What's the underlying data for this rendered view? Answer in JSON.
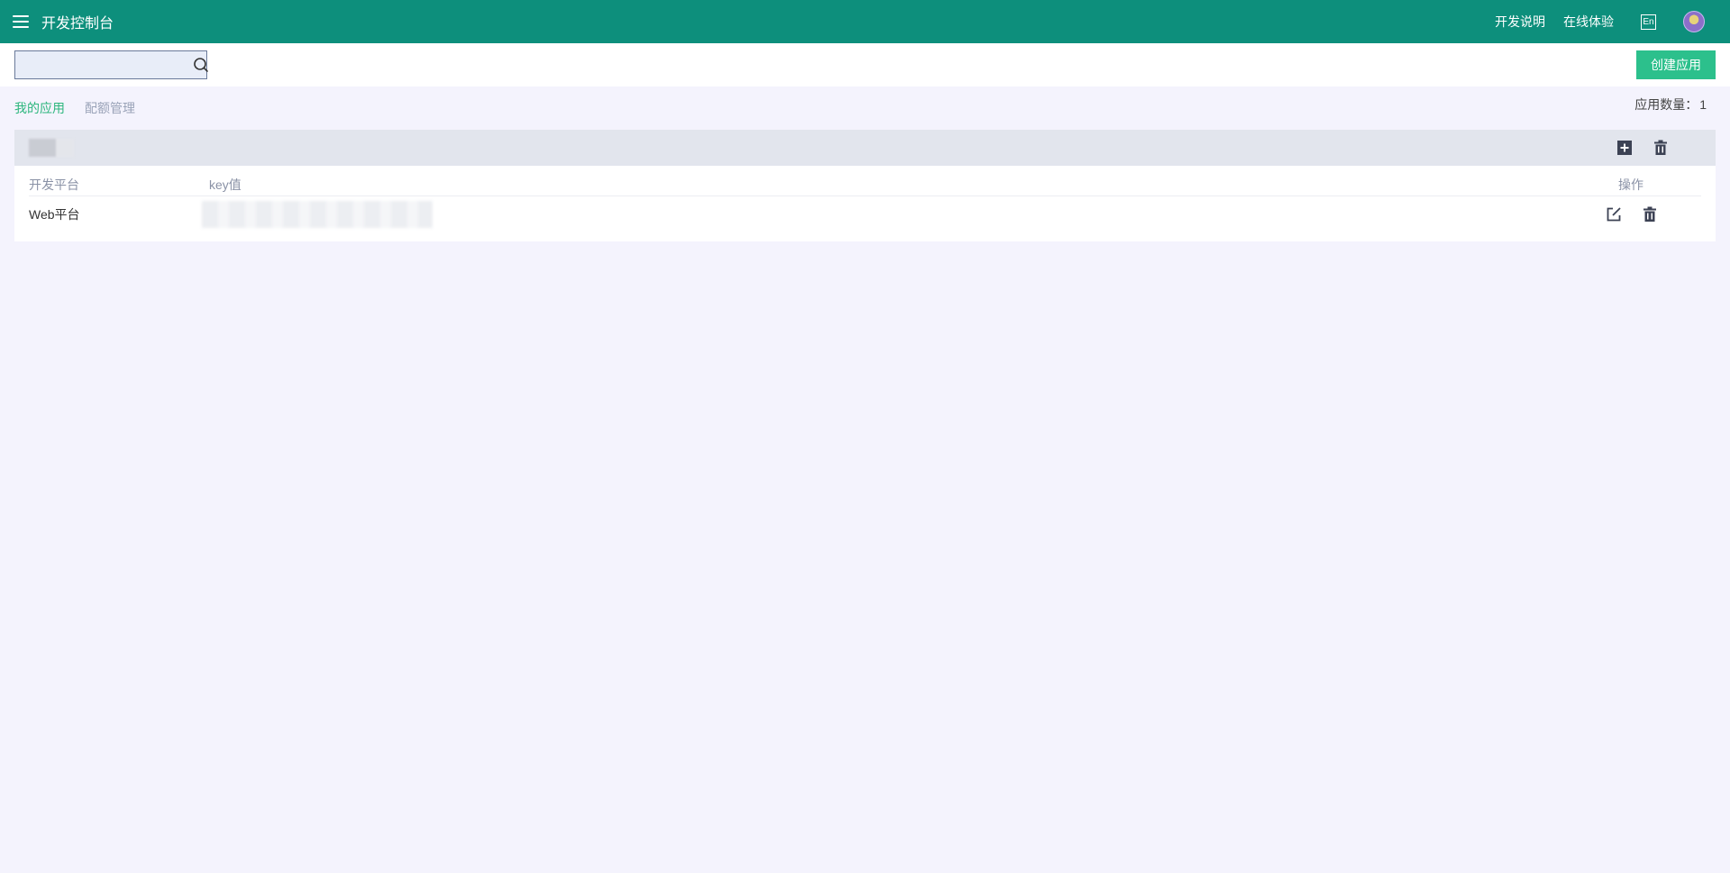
{
  "header": {
    "title": "开发控制台",
    "links": [
      "开发说明",
      "在线体验"
    ],
    "lang_label": "En"
  },
  "toolbar": {
    "search_value": "",
    "create_label": "创建应用"
  },
  "tabs": [
    {
      "label": "我的应用",
      "active": true
    },
    {
      "label": "配额管理",
      "active": false
    }
  ],
  "app_count": {
    "label": "应用数量：",
    "value": "1"
  },
  "table": {
    "columns": [
      "开发平台",
      "key值",
      "操作"
    ],
    "rows": [
      {
        "platform": "Web平台"
      }
    ]
  },
  "colors": {
    "header_bg": "#0d8f7c",
    "accent": "#2cc08c",
    "active_tab": "#2cb67d",
    "page_bg": "#f4f3fd"
  }
}
